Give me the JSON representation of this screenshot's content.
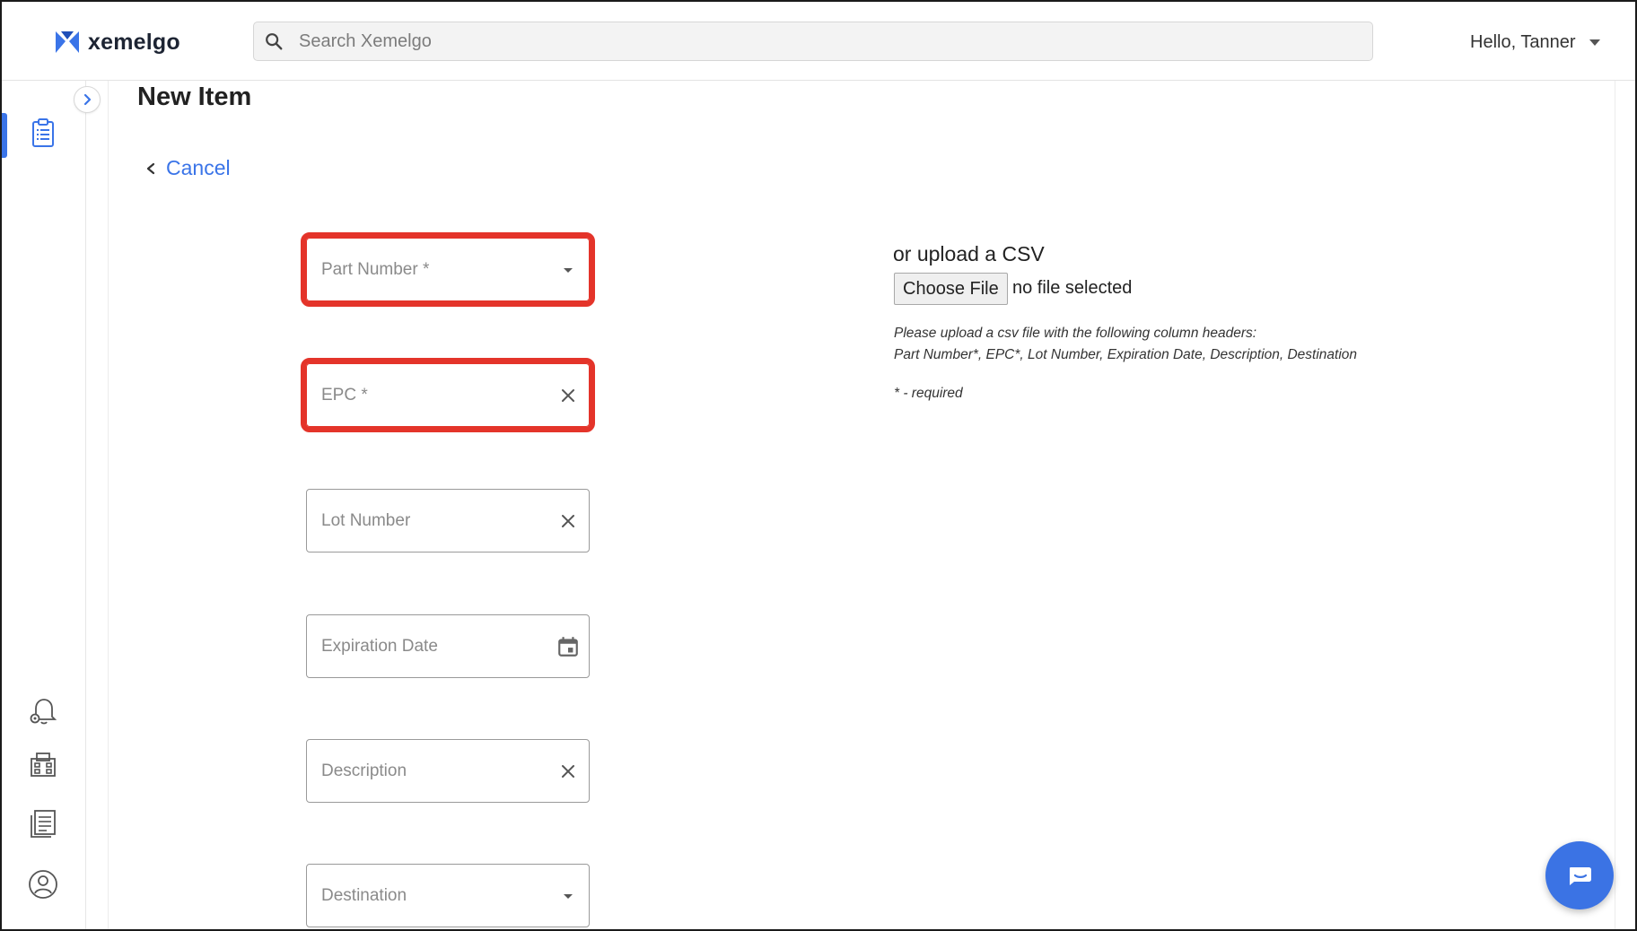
{
  "brand": {
    "name": "xemelgo",
    "accent": "#3a74e8"
  },
  "header": {
    "search_placeholder": "Search Xemelgo",
    "greeting": "Hello, Tanner"
  },
  "sidebar": {
    "items": [
      {
        "icon": "clipboard-icon",
        "active": true
      },
      {
        "icon": "bell-settings-icon",
        "active": false
      },
      {
        "icon": "building-icon",
        "active": false
      },
      {
        "icon": "list-document-icon",
        "active": false
      },
      {
        "icon": "user-circle-icon",
        "active": false
      }
    ]
  },
  "page": {
    "title": "New Item",
    "cancel_label": "Cancel"
  },
  "form": {
    "fields": [
      {
        "placeholder": "Part Number *",
        "trailing": "dropdown-arrow",
        "highlighted": true
      },
      {
        "placeholder": "EPC *",
        "trailing": "clear",
        "highlighted": true
      },
      {
        "placeholder": "Lot Number",
        "trailing": "clear",
        "highlighted": false
      },
      {
        "placeholder": "Expiration Date",
        "trailing": "calendar",
        "highlighted": false
      },
      {
        "placeholder": "Description",
        "trailing": "clear",
        "highlighted": false
      },
      {
        "placeholder": "Destination",
        "trailing": "dropdown-arrow",
        "highlighted": false
      }
    ]
  },
  "csv": {
    "title": "or upload a CSV",
    "choose_button": "Choose File",
    "file_status": "no file selected",
    "help_line1": "Please upload a csv file with the following column headers:",
    "help_line2": "Part Number*, EPC*, Lot Number, Expiration Date, Description, Destination",
    "required_note": "* - required"
  },
  "colors": {
    "highlight": "#e4342a",
    "chat": "#3b73e4"
  }
}
